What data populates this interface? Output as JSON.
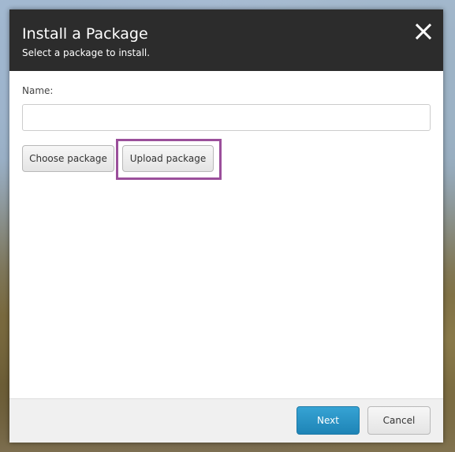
{
  "dialog": {
    "title": "Install a Package",
    "subtitle": "Select a package to install.",
    "close_icon": "close-icon"
  },
  "form": {
    "name_label": "Name:",
    "name_value": "",
    "name_placeholder": ""
  },
  "actions": {
    "choose_package_label": "Choose package",
    "upload_package_label": "Upload package"
  },
  "footer": {
    "next_label": "Next",
    "cancel_label": "Cancel"
  },
  "colors": {
    "header_bg": "#2c2c2c",
    "highlight": "#9b4f9b",
    "primary_button": "#1e84b6",
    "footer_bg": "#f0f0f0"
  }
}
